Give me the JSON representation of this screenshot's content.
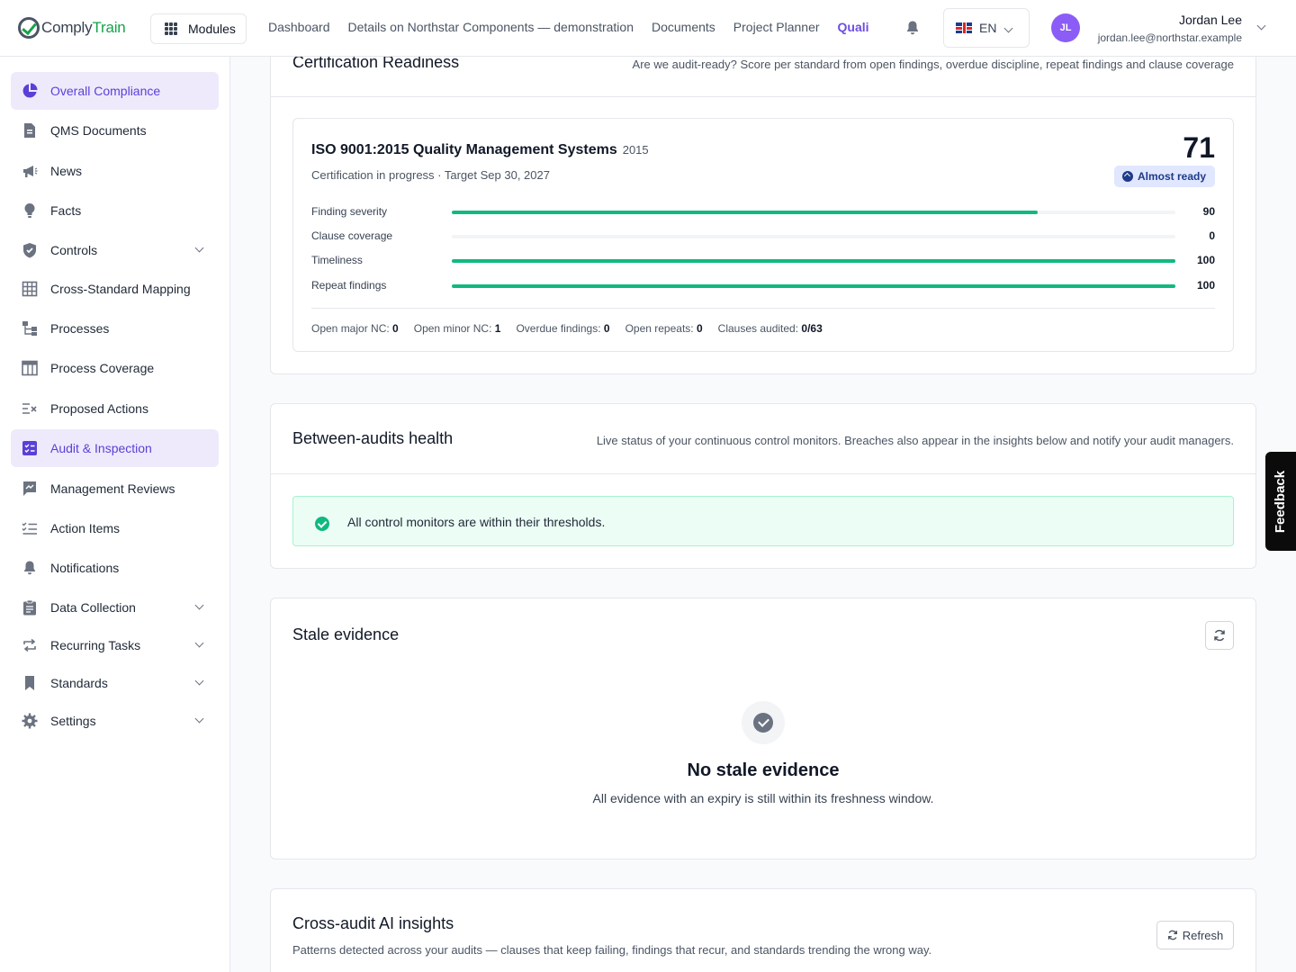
{
  "header": {
    "logo": {
      "part1": "Comply",
      "part2": "Train"
    },
    "modules_label": "Modules",
    "nav": [
      {
        "label": "Dashboard",
        "active": false
      },
      {
        "label": "Details on Northstar Components — demonstration",
        "active": false
      },
      {
        "label": "Documents",
        "active": false
      },
      {
        "label": "Project Planner",
        "active": false
      },
      {
        "label": "Quali",
        "active": true
      }
    ],
    "language": "EN",
    "user": {
      "initials": "JL",
      "name": "Jordan Lee",
      "email": "jordan.lee@northstar.example"
    }
  },
  "sidebar": {
    "items": [
      {
        "label": "Overall Compliance",
        "icon": "pie-chart-icon",
        "selected": true,
        "expandable": false
      },
      {
        "label": "QMS Documents",
        "icon": "document-icon",
        "selected": false,
        "expandable": false
      },
      {
        "label": "News",
        "icon": "megaphone-icon",
        "selected": false,
        "expandable": false
      },
      {
        "label": "Facts",
        "icon": "lightbulb-icon",
        "selected": false,
        "expandable": false
      },
      {
        "label": "Controls",
        "icon": "shield-check-icon",
        "selected": false,
        "expandable": true
      },
      {
        "label": "Cross-Standard Mapping",
        "icon": "table-grid-icon",
        "selected": false,
        "expandable": false
      },
      {
        "label": "Processes",
        "icon": "flow-icon",
        "selected": false,
        "expandable": false
      },
      {
        "label": "Process Coverage",
        "icon": "table-icon",
        "selected": false,
        "expandable": false
      },
      {
        "label": "Proposed Actions",
        "icon": "list-x-icon",
        "selected": false,
        "expandable": false
      },
      {
        "label": "Audit & Inspection",
        "icon": "checklist-icon",
        "selected": true,
        "expandable": false
      },
      {
        "label": "Management Reviews",
        "icon": "chart-line-icon",
        "selected": false,
        "expandable": false
      },
      {
        "label": "Action Items",
        "icon": "list-check-icon",
        "selected": false,
        "expandable": false
      },
      {
        "label": "Notifications",
        "icon": "bell-icon",
        "selected": false,
        "expandable": false
      },
      {
        "label": "Data Collection",
        "icon": "clipboard-icon",
        "selected": false,
        "expandable": true
      },
      {
        "label": "Recurring Tasks",
        "icon": "repeat-icon",
        "selected": false,
        "expandable": true
      },
      {
        "label": "Standards",
        "icon": "bookmark-icon",
        "selected": false,
        "expandable": true
      },
      {
        "label": "Settings",
        "icon": "gear-icon",
        "selected": false,
        "expandable": true
      }
    ]
  },
  "readiness": {
    "title": "Certification Readiness",
    "subtitle": "Are we audit-ready? Score per standard from open findings, overdue discipline, repeat findings and clause coverage",
    "standard": {
      "name": "ISO 9001:2015 Quality Management Systems",
      "year": "2015",
      "status": "Certification in progress · Target Sep 30, 2027",
      "score": "71",
      "badge": "Almost ready",
      "metrics": [
        {
          "label": "Finding severity",
          "value": 90,
          "display": "90"
        },
        {
          "label": "Clause coverage",
          "value": 0,
          "display": "0"
        },
        {
          "label": "Timeliness",
          "value": 100,
          "display": "100"
        },
        {
          "label": "Repeat findings",
          "value": 100,
          "display": "100"
        }
      ],
      "stats": [
        {
          "label": "Open major NC:",
          "value": "0"
        },
        {
          "label": "Open minor NC:",
          "value": "1"
        },
        {
          "label": "Overdue findings:",
          "value": "0"
        },
        {
          "label": "Open repeats:",
          "value": "0"
        },
        {
          "label": "Clauses audited:",
          "value": "0/63"
        }
      ]
    }
  },
  "health": {
    "title": "Between-audits health",
    "subtitle": "Live status of your continuous control monitors. Breaches also appear in the insights below and notify your audit managers.",
    "ok_message": "All control monitors are within their thresholds."
  },
  "stale": {
    "title": "Stale evidence",
    "empty_title": "No stale evidence",
    "empty_sub": "All evidence with an expiry is still within its freshness window."
  },
  "insights": {
    "title": "Cross-audit AI insights",
    "subtitle": "Patterns detected across your audits — clauses that keep failing, findings that recur, and standards trending the wrong way.",
    "refresh_label": "Refresh"
  },
  "feedback_label": "Feedback",
  "colors": {
    "accent": "#6d4ee0",
    "progress": "#10b981",
    "selected_bg": "#eeeafc",
    "success_bg": "#ecfdf5"
  }
}
